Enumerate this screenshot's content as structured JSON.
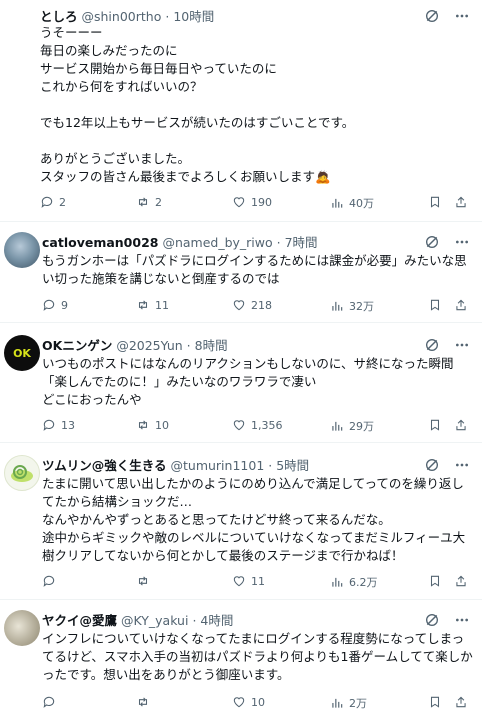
{
  "posts": [
    {
      "name": "としろ",
      "handle": "@shin00rtho",
      "time": "10時間",
      "text": "うそーーー\n毎日の楽しみだったのに\nサービス開始から毎日毎日やっていたのに\nこれから何をすればいいの？\n\nでも12年以上もサービスが続いたのはすごいことです。\n\nありがとうございました。\nスタッフの皆さん最後までよろしくお願いします🙇",
      "replies": "2",
      "reposts": "2",
      "likes": "190",
      "views": "40万"
    },
    {
      "name": "catloveman0028",
      "handle": "@named_by_riwo",
      "time": "7時間",
      "text": "もうガンホーは「パズドラにログインするためには課金が必要」みたいな思い切った施策を講じないと倒産するのでは",
      "replies": "9",
      "reposts": "11",
      "likes": "218",
      "views": "32万"
    },
    {
      "name": "OKニンゲン",
      "handle": "@2025Yun",
      "time": "8時間",
      "text": "いつものポストにはなんのリアクションもしないのに、サ終になった瞬間「楽しんでたのに！」みたいなのワラワラで凄い\nどこにおったんや",
      "replies": "13",
      "reposts": "10",
      "likes": "1,356",
      "views": "29万",
      "avatar_text": "OK"
    },
    {
      "name": "ツムリン@強く生きる",
      "handle": "@tumurin1101",
      "time": "5時間",
      "text": "たまに開いて思い出したかのようにのめり込んで満足してってのを繰り返してたから結構ショックだ…\nなんやかんやずっとあると思ってたけどサ終って来るんだな。\n途中からギミックや敵のレベルについていけなくなってまだミルフィーユ大樹クリアしてないから何とかして最後のステージまで行かねば！",
      "replies": "",
      "reposts": "",
      "likes": "11",
      "views": "6.2万"
    },
    {
      "name": "ヤクイ@愛鷹",
      "handle": "@KY_yakui",
      "time": "4時間",
      "text": "インフレについていけなくなってたまにログインする程度勢になってしまってるけど、スマホ入手の当初はパズドラより何よりも1番ゲームしてて楽しかったです。想い出をありがとう御座います。",
      "replies": "",
      "reposts": "",
      "likes": "10",
      "views": "2万"
    }
  ],
  "colors": {
    "text": "#0f1419",
    "muted": "#536471",
    "border": "#eff3f4",
    "grok": "#536471"
  },
  "icons": [
    "grok-icon",
    "more-icon",
    "reply-icon",
    "repost-icon",
    "like-icon",
    "views-icon",
    "bookmark-icon",
    "share-icon"
  ]
}
